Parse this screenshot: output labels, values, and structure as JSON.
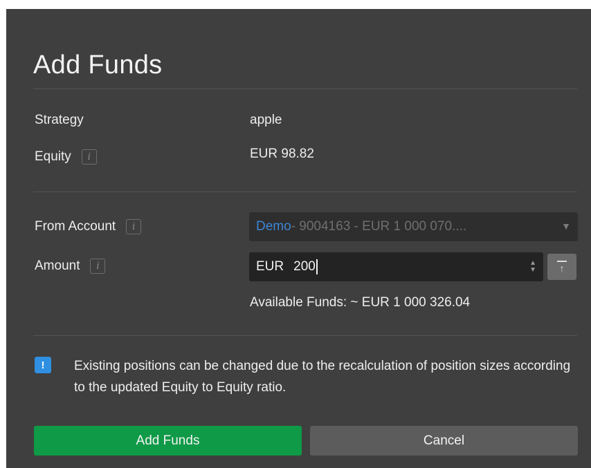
{
  "dialog": {
    "title": "Add Funds"
  },
  "strategy": {
    "label": "Strategy",
    "value": "apple"
  },
  "equity": {
    "label": "Equity",
    "value": "EUR 98.82",
    "info_icon": "i"
  },
  "from_account": {
    "label": "From Account",
    "info_icon": "i",
    "selected_prefix": "Demo",
    "selected_rest": " - 9004163 - EUR 1 000 070....",
    "caret": "▼"
  },
  "amount": {
    "label": "Amount",
    "info_icon": "i",
    "currency": "EUR",
    "value": "200",
    "spin_up": "▲",
    "spin_down": "▼",
    "max_arrow": "↑"
  },
  "available_funds": {
    "text": "Available Funds:  ~ EUR 1 000 326.04"
  },
  "notice": {
    "icon": "!",
    "text": "Existing positions can be changed due to the recalculation of position sizes according to the updated Equity to Equity ratio."
  },
  "buttons": {
    "add_label": "Add Funds",
    "cancel_label": "Cancel"
  },
  "colors": {
    "dialog_bg": "#3f3f3f",
    "primary_button": "#0f9a47",
    "secondary_button": "#5c5c5c",
    "accent_blue": "#3d86d6",
    "notice_icon": "#2f8fe0"
  }
}
